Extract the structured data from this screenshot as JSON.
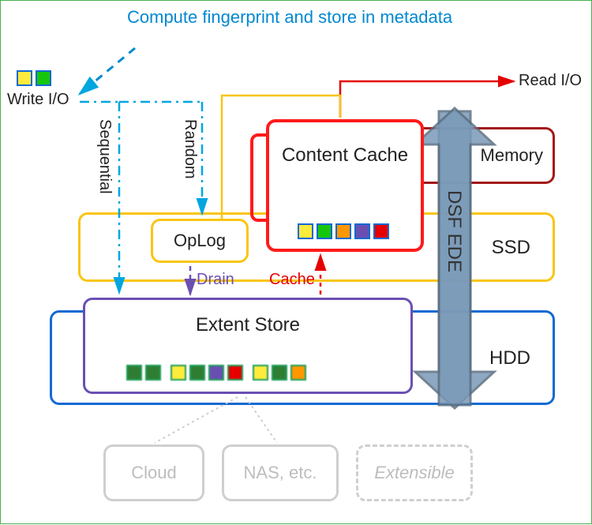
{
  "title": "Compute fingerprint and store in metadata",
  "labels": {
    "write_io": "Write I/O",
    "read_io": "Read I/O",
    "random": "Random",
    "sequential": "Sequential",
    "drain": "Drain",
    "cache": "Cache",
    "dsf_ede": "DSF EDE"
  },
  "tiers": {
    "memory": "Memory",
    "ssd": "SSD",
    "hdd": "HDD"
  },
  "components": {
    "content_cache": "Content Cache",
    "oplog": "OpLog",
    "extent_store": "Extent Store",
    "cloud": "Cloud",
    "nas": "NAS, etc.",
    "extensible": "Extensible"
  },
  "colors": {
    "memory_border": "#a31919",
    "ssd_border": "#f9c513",
    "hdd_border": "#1269d3",
    "extent_border": "#6a4fb3",
    "cache_border": "#ff1a1a",
    "read_line": "#e60000",
    "write_line": "#00a6e0",
    "drain_line": "#6a4fb3",
    "arrow_fill": "#6a8fb3"
  },
  "write_squares": [
    "yellow",
    "green"
  ],
  "cache_squares": [
    "yellow",
    "green",
    "orange",
    "purple",
    "red"
  ],
  "extent_groups": [
    [
      "dgreen",
      "dgreen"
    ],
    [
      "yellow",
      "dgreen",
      "purple",
      "red"
    ],
    [
      "yellow",
      "dgreen",
      "orange"
    ]
  ]
}
